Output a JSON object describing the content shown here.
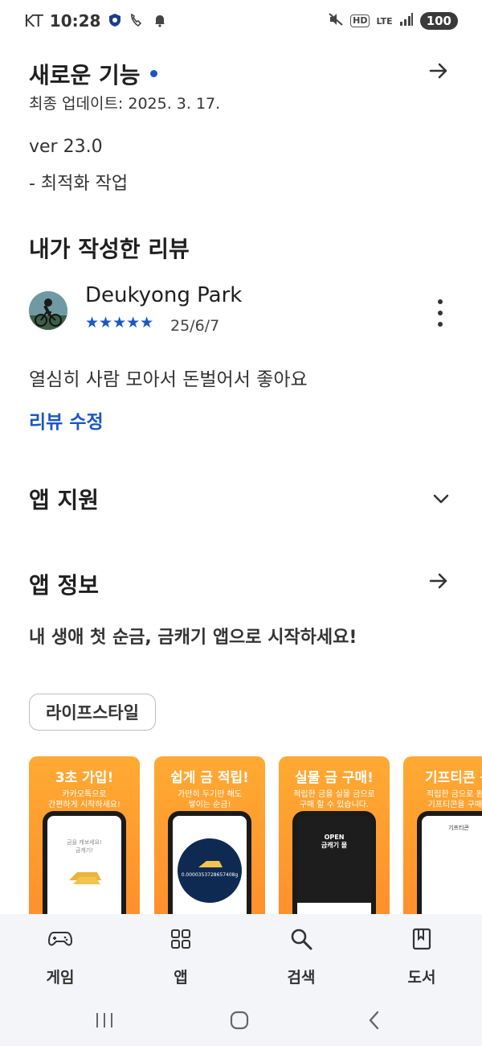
{
  "status_bar": {
    "carrier": "KT",
    "time": "10:28",
    "network": "LTE",
    "hd": "HD",
    "battery": "100"
  },
  "whats_new": {
    "title": "새로운 기능",
    "last_updated": "최종 업데이트: 2025. 3. 17.",
    "version": "ver 23.0",
    "notes": "- 최적화 작업"
  },
  "my_review": {
    "title": "내가 작성한 리뷰",
    "reviewer": "Deukyong Park",
    "stars": "★★★★★",
    "rating": 5,
    "date": "25/6/7",
    "text": "열심히 사람 모아서 돈벌어서 좋아요",
    "edit_link": "리뷰 수정"
  },
  "app_support": {
    "title": "앱 지원"
  },
  "app_info": {
    "title": "앱 정보",
    "description": "내 생애 첫 순금, 금캐기 앱으로 시작하세요!",
    "category_chip": "라이프스타일"
  },
  "screenshots": [
    {
      "title": "3초 가입!",
      "subtitle": "카카오톡으로\n간편하게 시작하세요!",
      "screen_text": "금을 캐보세요!\n금캐기!"
    },
    {
      "title": "쉽게 금 적립!",
      "subtitle": "가만히 두기만 해도\n쌓이는 순금!",
      "screen_text": "0.0000353728657408g"
    },
    {
      "title": "실물 금 구매!",
      "subtitle": "적립한 금을 실물 금으로\n구매 할 수 있습니다.",
      "screen_text": "OPEN\n금캐기 몰"
    },
    {
      "title": "기프티콘 구",
      "subtitle": "적립한 금으로 원하\n기프티콘을 구매하",
      "screen_text": "기프티콘"
    }
  ],
  "bottom_nav": [
    {
      "label": "게임",
      "icon": "gamepad-icon"
    },
    {
      "label": "앱",
      "icon": "apps-grid-icon"
    },
    {
      "label": "검색",
      "icon": "search-icon"
    },
    {
      "label": "도서",
      "icon": "book-icon"
    }
  ],
  "colors": {
    "accent": "#1a57c4",
    "screenshot_bg": "#ff9a30",
    "nav_bg": "#f3f5f8"
  }
}
